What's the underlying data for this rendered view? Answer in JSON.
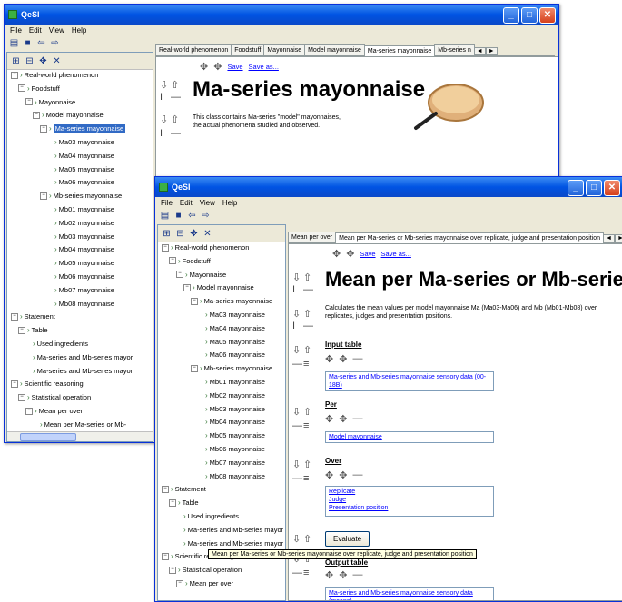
{
  "app_title": "QeSI",
  "menu": [
    "File",
    "Edit",
    "View",
    "Help"
  ],
  "colors": {
    "titlebar": "#0054e3",
    "selection": "#316ac5",
    "link": "#0000ff"
  },
  "win1": {
    "tree": [
      {
        "label": "Real-world phenomenon",
        "level": 0,
        "type": "minus"
      },
      {
        "label": "Foodstuff",
        "level": 1,
        "type": "minus"
      },
      {
        "label": "Mayonnaise",
        "level": 2,
        "type": "minus"
      },
      {
        "label": "Model mayonnaise",
        "level": 3,
        "type": "minus"
      },
      {
        "label": "Ma-series mayonnaise",
        "level": 4,
        "type": "minus",
        "selected": true
      },
      {
        "label": "Ma03 mayonnaise",
        "level": 5,
        "type": "leaf"
      },
      {
        "label": "Ma04 mayonnaise",
        "level": 5,
        "type": "leaf"
      },
      {
        "label": "Ma05 mayonnaise",
        "level": 5,
        "type": "leaf"
      },
      {
        "label": "Ma06 mayonnaise",
        "level": 5,
        "type": "leaf"
      },
      {
        "label": "Mb-series mayonnaise",
        "level": 4,
        "type": "minus"
      },
      {
        "label": "Mb01 mayonnaise",
        "level": 5,
        "type": "leaf"
      },
      {
        "label": "Mb02 mayonnaise",
        "level": 5,
        "type": "leaf"
      },
      {
        "label": "Mb03 mayonnaise",
        "level": 5,
        "type": "leaf"
      },
      {
        "label": "Mb04 mayonnaise",
        "level": 5,
        "type": "leaf"
      },
      {
        "label": "Mb05 mayonnaise",
        "level": 5,
        "type": "leaf"
      },
      {
        "label": "Mb06 mayonnaise",
        "level": 5,
        "type": "leaf"
      },
      {
        "label": "Mb07 mayonnaise",
        "level": 5,
        "type": "leaf"
      },
      {
        "label": "Mb08 mayonnaise",
        "level": 5,
        "type": "leaf"
      },
      {
        "label": "Statement",
        "level": 0,
        "type": "minus"
      },
      {
        "label": "Table",
        "level": 1,
        "type": "minus"
      },
      {
        "label": "Used ingredients",
        "level": 2,
        "type": "leaf"
      },
      {
        "label": "Ma-series and Mb-series mayor",
        "level": 2,
        "type": "leaf"
      },
      {
        "label": "Ma-series and Mb-series mayor",
        "level": 2,
        "type": "leaf"
      },
      {
        "label": "Scientific reasoning",
        "level": 0,
        "type": "minus"
      },
      {
        "label": "Statistical operation",
        "level": 1,
        "type": "minus"
      },
      {
        "label": "Mean per over",
        "level": 2,
        "type": "minus"
      },
      {
        "label": "Mean per Ma-series or Mb-",
        "level": 3,
        "type": "leaf"
      }
    ],
    "tabs": [
      "Real-world phenomenon",
      "Foodstuff",
      "Mayonnaise",
      "Model mayonnaise",
      "Ma-series mayonnaise",
      "Mb-series n"
    ],
    "active_tab": 4,
    "save": "Save",
    "save_as": "Save as...",
    "title": "Ma-series mayonnaise",
    "description": "This class contains Ma-series \"model\" mayonnaises, the actual phenomena studied and observed."
  },
  "win2": {
    "tree": [
      {
        "label": "Real-world phenomenon",
        "level": 0,
        "type": "minus"
      },
      {
        "label": "Foodstuff",
        "level": 1,
        "type": "minus"
      },
      {
        "label": "Mayonnaise",
        "level": 2,
        "type": "minus"
      },
      {
        "label": "Model mayonnaise",
        "level": 3,
        "type": "minus"
      },
      {
        "label": "Ma-series mayonnaise",
        "level": 4,
        "type": "minus"
      },
      {
        "label": "Ma03 mayonnaise",
        "level": 5,
        "type": "leaf"
      },
      {
        "label": "Ma04 mayonnaise",
        "level": 5,
        "type": "leaf"
      },
      {
        "label": "Ma05 mayonnaise",
        "level": 5,
        "type": "leaf"
      },
      {
        "label": "Ma06 mayonnaise",
        "level": 5,
        "type": "leaf"
      },
      {
        "label": "Mb-series mayonnaise",
        "level": 4,
        "type": "minus"
      },
      {
        "label": "Mb01 mayonnaise",
        "level": 5,
        "type": "leaf"
      },
      {
        "label": "Mb02 mayonnaise",
        "level": 5,
        "type": "leaf"
      },
      {
        "label": "Mb03 mayonnaise",
        "level": 5,
        "type": "leaf"
      },
      {
        "label": "Mb04 mayonnaise",
        "level": 5,
        "type": "leaf"
      },
      {
        "label": "Mb05 mayonnaise",
        "level": 5,
        "type": "leaf"
      },
      {
        "label": "Mb06 mayonnaise",
        "level": 5,
        "type": "leaf"
      },
      {
        "label": "Mb07 mayonnaise",
        "level": 5,
        "type": "leaf"
      },
      {
        "label": "Mb08 mayonnaise",
        "level": 5,
        "type": "leaf"
      },
      {
        "label": "Statement",
        "level": 0,
        "type": "minus"
      },
      {
        "label": "Table",
        "level": 1,
        "type": "minus"
      },
      {
        "label": "Used ingredients",
        "level": 2,
        "type": "leaf"
      },
      {
        "label": "Ma-series and Mb-series mayor",
        "level": 2,
        "type": "leaf"
      },
      {
        "label": "Ma-series and Mb-series mayor",
        "level": 2,
        "type": "leaf"
      },
      {
        "label": "Scientific reasoning",
        "level": 0,
        "type": "minus"
      },
      {
        "label": "Statistical operation",
        "level": 1,
        "type": "minus"
      },
      {
        "label": "Mean per over",
        "level": 2,
        "type": "minus"
      }
    ],
    "tabs": [
      "Mean per over",
      "Mean per Ma-series or Mb-series mayonnaise over replicate, judge and presentation position"
    ],
    "active_tab": 1,
    "save": "Save",
    "save_as": "Save as...",
    "title": "Mean per Ma-series or Mb-series m",
    "description": "Calculates the mean values per model mayonnaise Ma (Ma03-Ma06) and Mb (Mb01-Mb08) over replicates, judges and presentation positions.",
    "input_table_label": "Input table",
    "input_table_value": "Ma-series and Mb-series mayonnaise sensory data (00-18B)",
    "per_label": "Per",
    "per_value": "Model mayonnaise",
    "over_label": "Over",
    "over_values": [
      "Replicate",
      "Judge",
      "Presentation position"
    ],
    "evaluate_label": "Evaluate",
    "output_table_label": "Output table",
    "output_table_value": "Ma-series and Mb-series mayonnaise sensory data (means)",
    "tooltip": "Mean per Ma-series or Mb-series mayonnaise over replicate, judge and presentation position"
  }
}
